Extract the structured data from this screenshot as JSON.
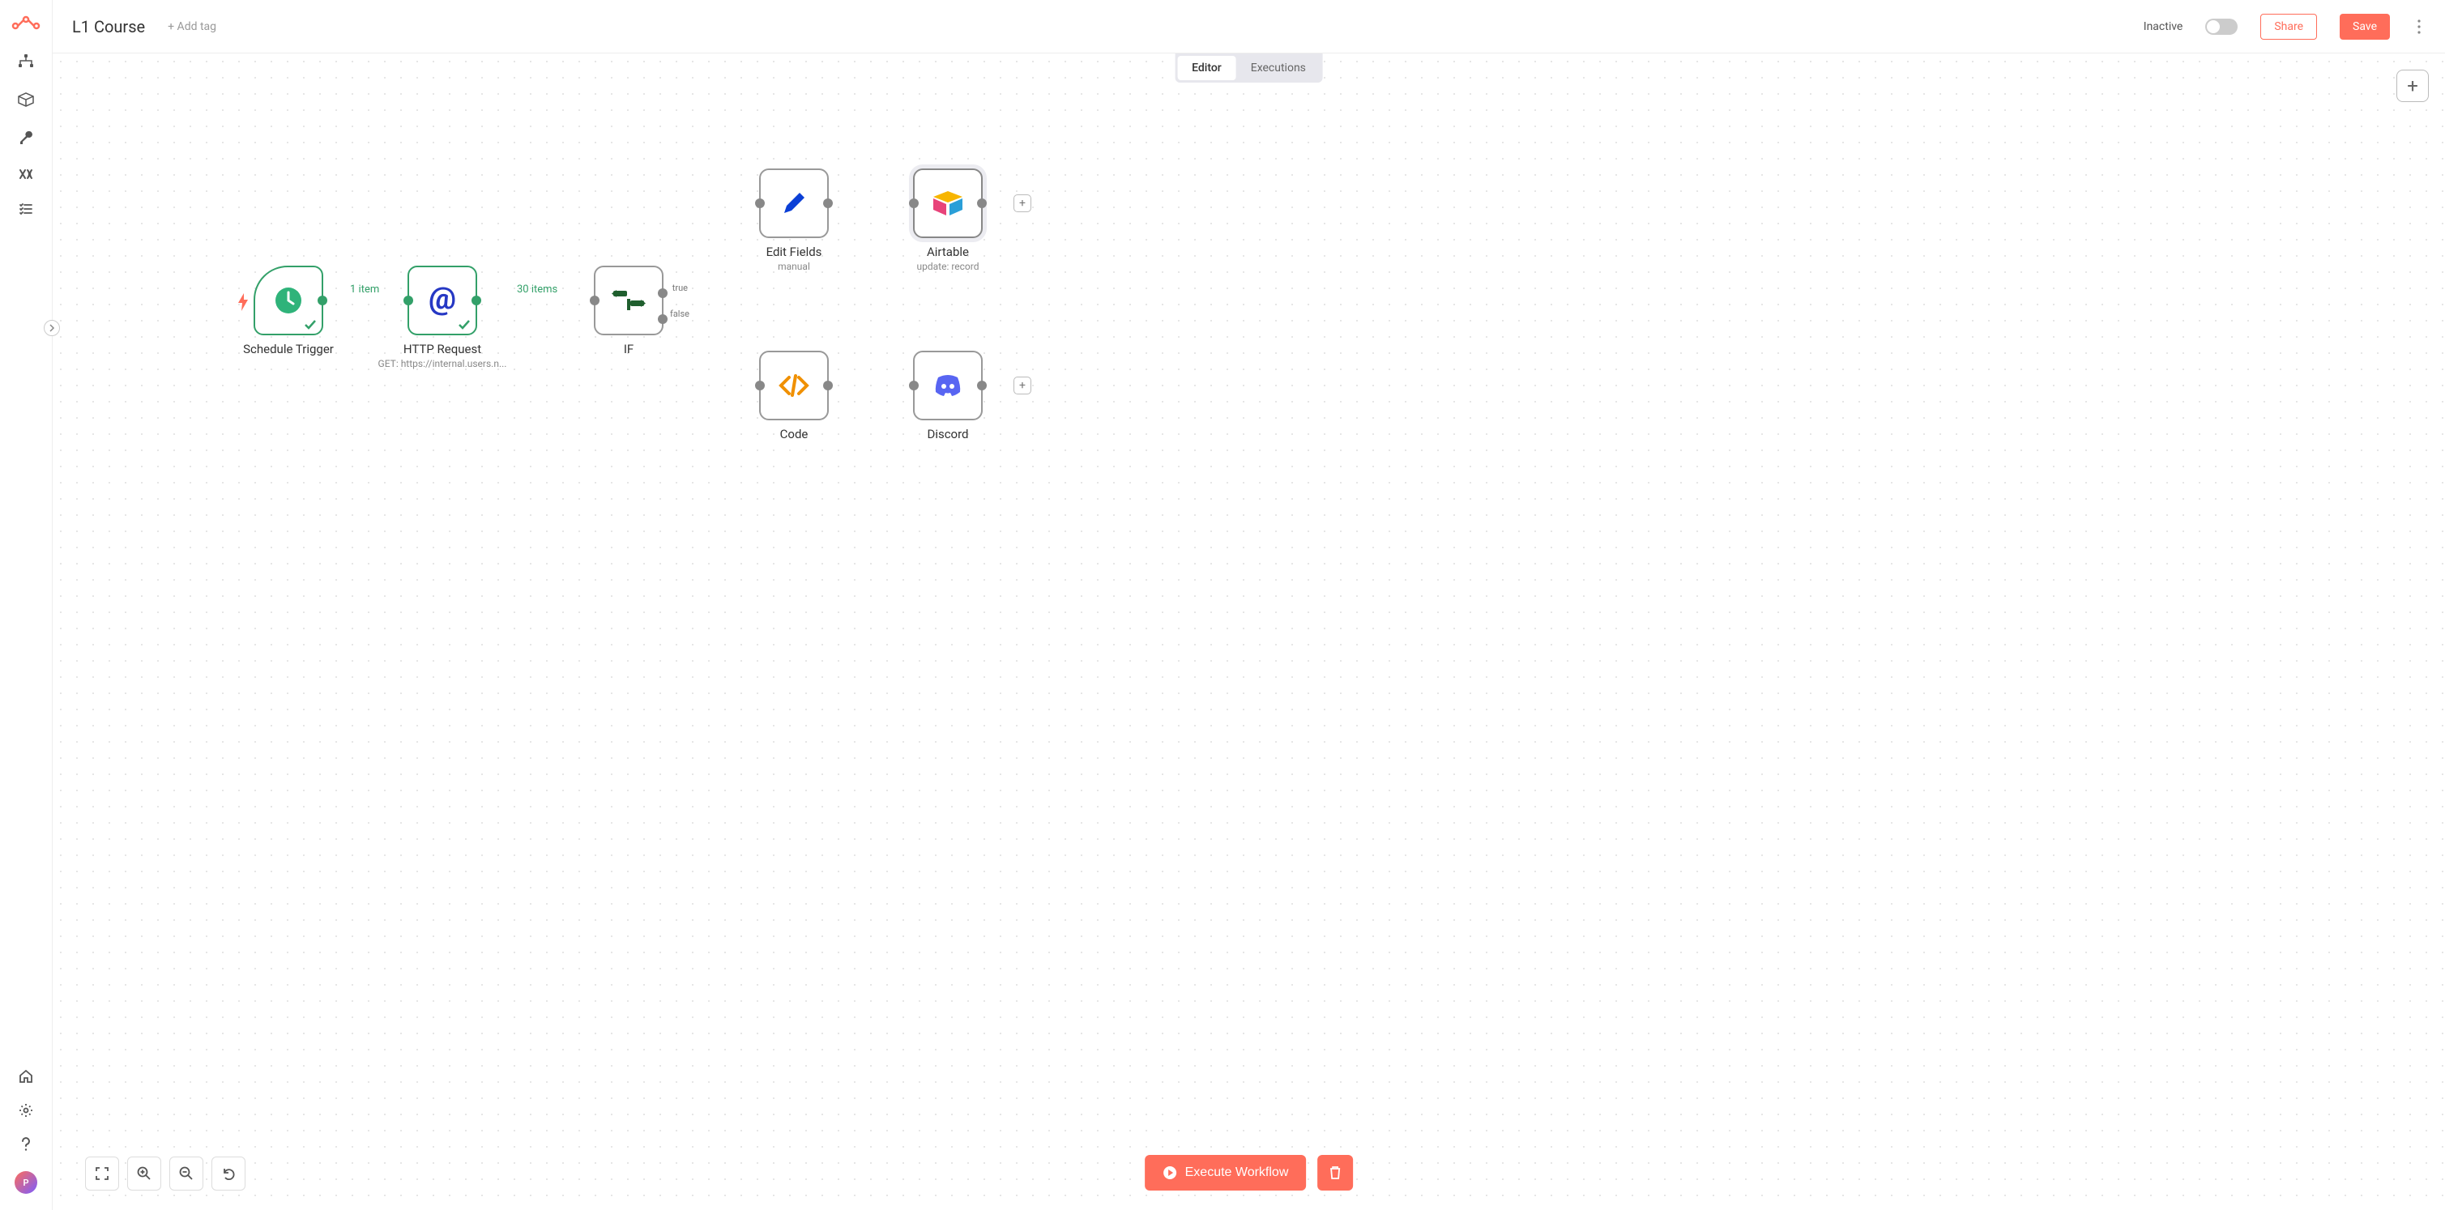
{
  "header": {
    "title": "L1 Course",
    "add_tag": "+ Add tag",
    "inactive": "Inactive",
    "share": "Share",
    "save": "Save"
  },
  "tabs": {
    "editor": "Editor",
    "executions": "Executions"
  },
  "avatar_initial": "P",
  "edges": {
    "edge1_label": "1 item",
    "edge2_label": "30 items",
    "if_true": "true",
    "if_false": "false"
  },
  "nodes": {
    "schedule": {
      "title": "Schedule Trigger"
    },
    "http": {
      "title": "HTTP Request",
      "sub": "GET: https://internal.users.n..."
    },
    "if": {
      "title": "IF"
    },
    "edit": {
      "title": "Edit Fields",
      "sub": "manual"
    },
    "airtable": {
      "title": "Airtable",
      "sub": "update: record"
    },
    "code": {
      "title": "Code"
    },
    "discord": {
      "title": "Discord"
    }
  },
  "actions": {
    "execute": "Execute Workflow",
    "add": "+"
  }
}
